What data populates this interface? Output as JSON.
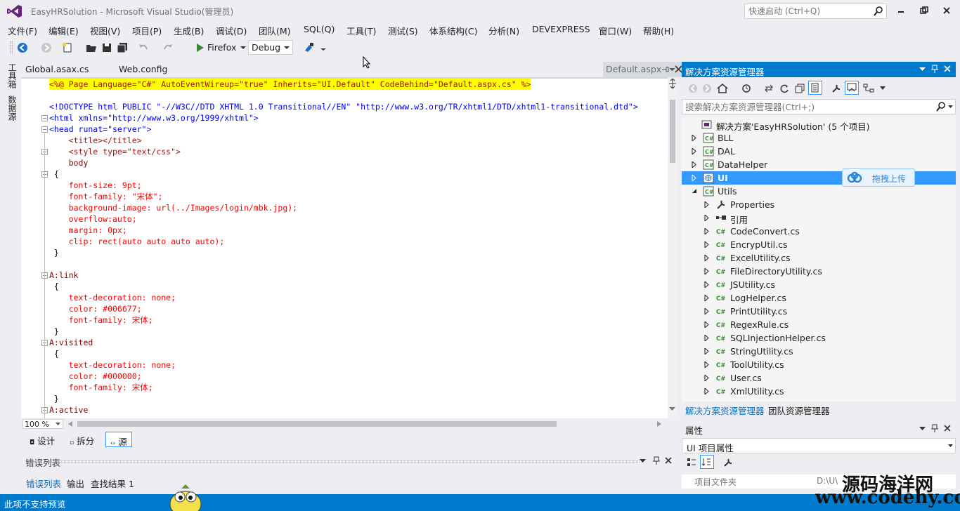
{
  "window": {
    "title": "EasyHRSolution - Microsoft Visual Studio(管理员)",
    "quicklaunch_placeholder": "快速启动 (Ctrl+Q)"
  },
  "menu": [
    "文件(F)",
    "编辑(E)",
    "视图(V)",
    "项目(P)",
    "生成(B)",
    "调试(D)",
    "团队(M)",
    "SQL(Q)",
    "工具(T)",
    "测试(S)",
    "体系结构(C)",
    "分析(N)",
    "DEVEXPRESS",
    "窗口(W)",
    "帮助(H)"
  ],
  "toolbar": {
    "run_target": "Firefox",
    "configuration": "Debug"
  },
  "left_strip": {
    "toolbox": "工具箱",
    "datasource": "数据源"
  },
  "doc_tabs": {
    "tab1": "Global.asax.cs",
    "tab2": "Web.config",
    "active": "Default.aspx"
  },
  "code_lines": [
    {
      "y": 0,
      "text": "<%@ Page Language=\"C#\" AutoEventWireup=\"true\" Inherits=\"UI.Default\" CodeBehind=\"Default.aspx.cs\" %>",
      "color": "#a31515",
      "bg": "#ffff00"
    },
    {
      "y": 2,
      "text": "<!DOCTYPE html PUBLIC \"-//W3C//DTD XHTML 1.0 Transitional//EN\" \"http://www.w3.org/TR/xhtml1/DTD/xhtml1-transitional.dtd\">",
      "color": "#0000ff"
    },
    {
      "y": 3,
      "text": "<html xmlns=\"http://www.w3.org/1999/xhtml\">",
      "color": "#0000ff"
    },
    {
      "y": 4,
      "text": "<head runat=\"server\">",
      "color": "#0000ff"
    },
    {
      "y": 5,
      "text": "    <title></title>",
      "color": "#a31515"
    },
    {
      "y": 6,
      "text": "    <style type=\"text/css\">",
      "color": "#a31515"
    },
    {
      "y": 7,
      "text": "    body",
      "color": "#800000"
    },
    {
      "y": 8,
      "text": " {",
      "color": "#000000"
    },
    {
      "y": 9,
      "text": "    font-size: 9pt;",
      "color": "#ff0000"
    },
    {
      "y": 10,
      "text": "    font-family: \"宋体\";",
      "color": "#ff0000"
    },
    {
      "y": 11,
      "text": "    background-image: url(../Images/login/mbk.jpg);",
      "color": "#ff0000"
    },
    {
      "y": 12,
      "text": "    overflow:auto;",
      "color": "#ff0000"
    },
    {
      "y": 13,
      "text": "    margin: 0px;",
      "color": "#ff0000"
    },
    {
      "y": 14,
      "text": "    clip: rect(auto auto auto auto);",
      "color": "#ff0000"
    },
    {
      "y": 15,
      "text": " }",
      "color": "#000000"
    },
    {
      "y": 17,
      "text": "A:link",
      "color": "#800000"
    },
    {
      "y": 18,
      "text": " {",
      "color": "#000000"
    },
    {
      "y": 19,
      "text": "    text-decoration: none;",
      "color": "#ff0000"
    },
    {
      "y": 20,
      "text": "    color: #006677;",
      "color": "#ff0000"
    },
    {
      "y": 21,
      "text": "    font-family: 宋体;",
      "color": "#ff0000"
    },
    {
      "y": 22,
      "text": " }",
      "color": "#000000"
    },
    {
      "y": 23,
      "text": "A:visited",
      "color": "#800000"
    },
    {
      "y": 24,
      "text": " {",
      "color": "#000000"
    },
    {
      "y": 25,
      "text": "    text-decoration: none;",
      "color": "#ff0000"
    },
    {
      "y": 26,
      "text": "    color: #000000;",
      "color": "#ff0000"
    },
    {
      "y": 27,
      "text": "    font-family: 宋体;",
      "color": "#ff0000"
    },
    {
      "y": 28,
      "text": " }",
      "color": "#000000"
    },
    {
      "y": 29,
      "text": "A:active",
      "color": "#800000"
    }
  ],
  "editor": {
    "zoom": "100 %"
  },
  "view_buttons": {
    "design": "设计",
    "split": "拆分",
    "source": "源"
  },
  "error_list": {
    "title": "错误列表",
    "tabs": [
      "错误列表",
      "输出",
      "查找结果 1"
    ]
  },
  "status": "此项不支持预览",
  "solution_explorer": {
    "title": "解决方案资源管理器",
    "search_placeholder": "搜索解决方案资源管理器(Ctrl+;)",
    "tree": [
      {
        "label": "解决方案'EasyHRSolution' (5 个项目)",
        "indent": 0,
        "icon": "solution-icon",
        "arrow": "none"
      },
      {
        "label": "BLL",
        "indent": 1,
        "icon": "csharp-project-icon",
        "arrow": "collapsed"
      },
      {
        "label": "DAL",
        "indent": 1,
        "icon": "csharp-project-icon",
        "arrow": "collapsed"
      },
      {
        "label": "DataHelper",
        "indent": 1,
        "icon": "csharp-project-icon",
        "arrow": "collapsed"
      },
      {
        "label": "UI",
        "indent": 1,
        "icon": "web-project-icon",
        "arrow": "collapsed",
        "selected": true
      },
      {
        "label": "Utils",
        "indent": 1,
        "icon": "csharp-project-icon",
        "arrow": "expanded"
      },
      {
        "label": "Properties",
        "indent": 2,
        "icon": "wrench-icon",
        "arrow": "collapsed"
      },
      {
        "label": "引用",
        "indent": 2,
        "icon": "references-icon",
        "arrow": "collapsed"
      },
      {
        "label": "CodeConvert.cs",
        "indent": 2,
        "icon": "csharp-file-icon",
        "arrow": "collapsed"
      },
      {
        "label": "EncrypUtil.cs",
        "indent": 2,
        "icon": "csharp-file-icon",
        "arrow": "collapsed"
      },
      {
        "label": "ExcelUtility.cs",
        "indent": 2,
        "icon": "csharp-file-icon",
        "arrow": "collapsed"
      },
      {
        "label": "FileDirectoryUtility.cs",
        "indent": 2,
        "icon": "csharp-file-icon",
        "arrow": "collapsed"
      },
      {
        "label": "JSUtility.cs",
        "indent": 2,
        "icon": "csharp-file-icon",
        "arrow": "collapsed"
      },
      {
        "label": "LogHelper.cs",
        "indent": 2,
        "icon": "csharp-file-icon",
        "arrow": "collapsed"
      },
      {
        "label": "PrintUtility.cs",
        "indent": 2,
        "icon": "csharp-file-icon",
        "arrow": "collapsed"
      },
      {
        "label": "RegexRule.cs",
        "indent": 2,
        "icon": "csharp-file-icon",
        "arrow": "collapsed"
      },
      {
        "label": "SQLInjectionHelper.cs",
        "indent": 2,
        "icon": "csharp-file-icon",
        "arrow": "collapsed"
      },
      {
        "label": "StringUtility.cs",
        "indent": 2,
        "icon": "csharp-file-icon",
        "arrow": "collapsed"
      },
      {
        "label": "ToolUtility.cs",
        "indent": 2,
        "icon": "csharp-file-icon",
        "arrow": "collapsed"
      },
      {
        "label": "User.cs",
        "indent": 2,
        "icon": "csharp-file-icon",
        "arrow": "collapsed"
      },
      {
        "label": "XmlUtility.cs",
        "indent": 2,
        "icon": "csharp-file-icon",
        "arrow": "collapsed"
      }
    ],
    "upload_badge": "拖拽上传",
    "bottom_tabs": [
      "解决方案资源管理器",
      "团队资源管理器"
    ]
  },
  "properties": {
    "title": "属性",
    "object": "UI 项目属性",
    "row_name": "项目文件夹",
    "row_value": "D:\\U\\"
  },
  "watermark": {
    "line1": "源码海洋网",
    "line2": "www.codehy.com"
  },
  "colors": {
    "accent": "#007acc",
    "selection": "#3399ff",
    "chrome": "#eeeef2"
  }
}
